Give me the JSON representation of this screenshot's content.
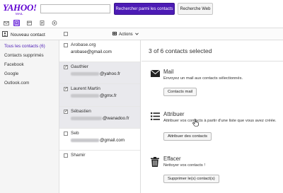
{
  "header": {
    "logo_main": "YAHOO!",
    "logo_sub": "MAIL",
    "search_value": "",
    "search_contacts_label": "Rechercher parmi les contacts",
    "search_web_label": "Recherche Web",
    "brand_color": "#5f01d1"
  },
  "appbar": {
    "icons": [
      "mail-icon",
      "contacts-icon",
      "calendar-icon",
      "notepad-icon",
      "messenger-icon"
    ],
    "active": "contacts-icon"
  },
  "toolbar": {
    "new_contact_label": "Nouveau contact",
    "actions_label": "Actions"
  },
  "sidebar": {
    "items": [
      {
        "label": "Tous les contacts (6)"
      },
      {
        "label": "Contacts supprimés"
      },
      {
        "label": "Facebook"
      },
      {
        "label": "Google"
      },
      {
        "label": "Outlook.com"
      }
    ]
  },
  "contacts": [
    {
      "name": "Arobase.org",
      "email": "arobase@gmail.com",
      "checked": false
    },
    {
      "name": "Gauthier",
      "email": "@yahoo.fr",
      "checked": true
    },
    {
      "name": "Laurent Martin",
      "email": "@gmx.fr",
      "checked": true
    },
    {
      "name": "Sébastien",
      "email": "@wanadoo.fr",
      "checked": true
    },
    {
      "name": "Seb",
      "email": "@gmail.com",
      "checked": false
    },
    {
      "name": "Shamir",
      "email": "",
      "checked": false
    }
  ],
  "panel": {
    "selection_text": "3 of 6 contacts selected",
    "mail": {
      "title": "Mail",
      "desc": "Envoyez un mail aux contacts sélectionnés.",
      "button": "Contacts mail"
    },
    "assign": {
      "title": "Attribuer",
      "desc": "Attribuer vos contacts à partir d'une liste que vous avez créée.",
      "button": "Attribuer des contacts"
    },
    "delete": {
      "title": "Effacer",
      "desc": "Nettoyer vos contacts !",
      "button": "Supprimer le(s) contact(s)"
    }
  }
}
